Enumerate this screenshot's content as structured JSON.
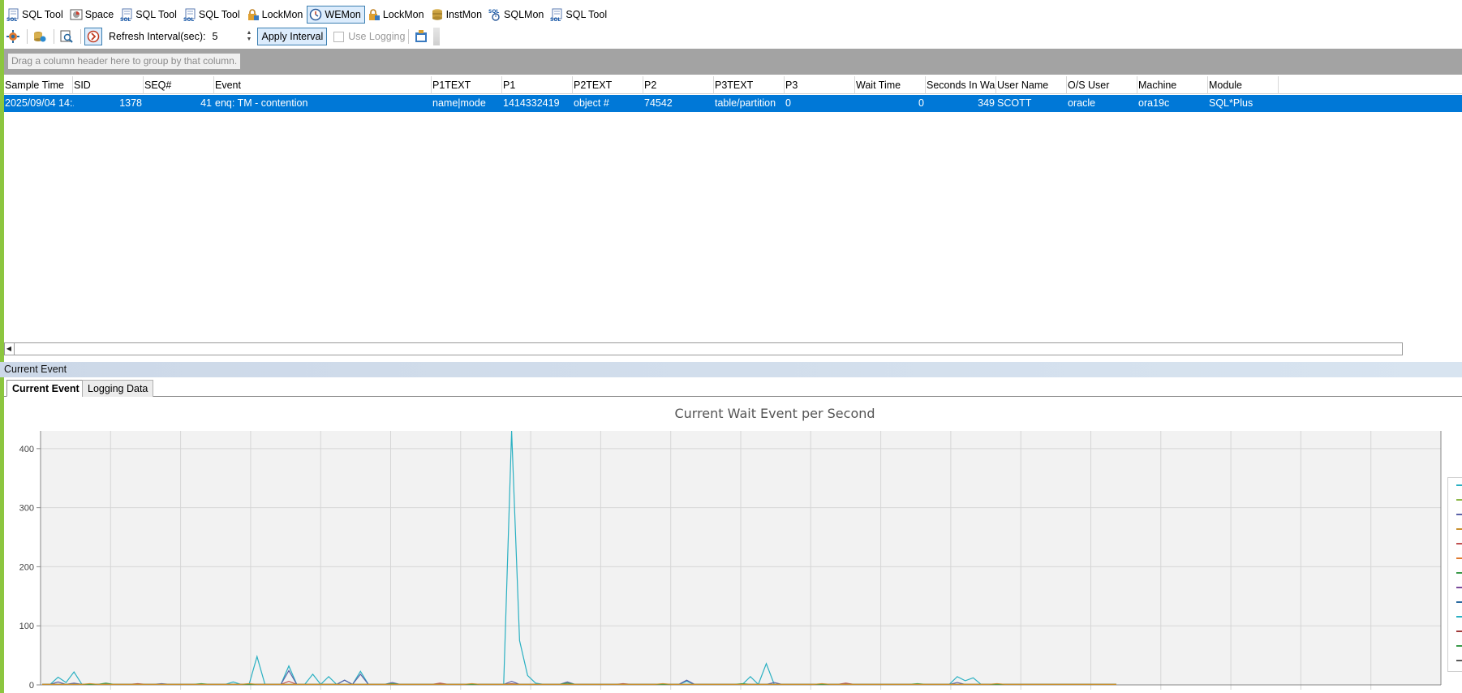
{
  "toolbar": {
    "tabs": [
      {
        "label": "SQL Tool",
        "icon": "sql-icon",
        "active": false
      },
      {
        "label": "Space",
        "icon": "space-icon",
        "active": false
      },
      {
        "label": "SQL Tool",
        "icon": "sql-icon",
        "active": false
      },
      {
        "label": "SQL Tool",
        "icon": "sql-icon",
        "active": false
      },
      {
        "label": "LockMon",
        "icon": "lock-icon",
        "active": false
      },
      {
        "label": "WEMon",
        "icon": "clock-icon",
        "active": true
      },
      {
        "label": "LockMon",
        "icon": "lock-icon",
        "active": false
      },
      {
        "label": "InstMon",
        "icon": "database-icon",
        "active": false
      },
      {
        "label": "SQLMon",
        "icon": "sqlmon-icon",
        "active": false
      },
      {
        "label": "SQL Tool",
        "icon": "sql-icon",
        "active": false
      }
    ],
    "refresh_label": "Refresh Interval(sec):",
    "refresh_value": "5",
    "apply_label": "Apply Interval",
    "use_logging_label": "Use Logging"
  },
  "group_panel": {
    "hint": "Drag a column header here to group by that column."
  },
  "grid": {
    "columns": [
      "Sample Time",
      "SID",
      "SEQ#",
      "Event",
      "P1TEXT",
      "P1",
      "P2TEXT",
      "P2",
      "P3TEXT",
      "P3",
      "Wait Time",
      "Seconds In Wait",
      "User Name",
      "O/S User",
      "Machine",
      "Module"
    ],
    "rows": [
      [
        "2025/09/04 14:...",
        "1378",
        "41",
        "enq: TM - contention",
        "name|mode",
        "1414332419",
        "object #",
        "74542",
        "table/partition",
        "0",
        "0",
        "349",
        "SCOTT",
        "oracle",
        "ora19c",
        "SQL*Plus"
      ]
    ]
  },
  "section": {
    "title": "Current Event"
  },
  "tabs": {
    "current_event": "Current Event",
    "logging_data": "Logging Data"
  },
  "chart_data": {
    "type": "line",
    "title": "Current Wait Event per Second",
    "xlabel": "",
    "ylabel": "",
    "ylim": [
      0,
      430
    ],
    "yticks": [
      0,
      100,
      200,
      300,
      400
    ],
    "grid": true,
    "x_count": 136,
    "series": [
      {
        "color": "#2ab0c2",
        "spikes": [
          [
            2,
            13
          ],
          [
            3,
            4
          ],
          [
            4,
            22
          ],
          [
            24,
            5
          ],
          [
            27,
            48
          ],
          [
            31,
            32
          ],
          [
            34,
            18
          ],
          [
            36,
            14
          ],
          [
            38,
            8
          ],
          [
            40,
            23
          ],
          [
            59,
            430
          ],
          [
            60,
            75
          ],
          [
            61,
            16
          ],
          [
            62,
            3
          ],
          [
            81,
            6
          ],
          [
            89,
            14
          ],
          [
            91,
            36
          ],
          [
            115,
            14
          ],
          [
            116,
            7
          ],
          [
            117,
            12
          ]
        ]
      },
      {
        "color": "#5b62a8",
        "spikes": [
          [
            2,
            5
          ],
          [
            4,
            3
          ],
          [
            15,
            2
          ],
          [
            31,
            24
          ],
          [
            38,
            8
          ],
          [
            40,
            18
          ],
          [
            44,
            4
          ],
          [
            59,
            6
          ],
          [
            66,
            5
          ],
          [
            81,
            8
          ],
          [
            92,
            4
          ],
          [
            115,
            4
          ]
        ]
      },
      {
        "color": "#c05050",
        "spikes": [
          [
            12,
            2
          ],
          [
            31,
            6
          ],
          [
            50,
            3
          ],
          [
            59,
            2
          ],
          [
            73,
            2
          ],
          [
            101,
            3
          ]
        ]
      },
      {
        "color": "#3a9a4a",
        "spikes": [
          [
            8,
            3
          ],
          [
            20,
            2
          ],
          [
            44,
            2
          ],
          [
            66,
            3
          ],
          [
            88,
            2
          ],
          [
            110,
            2
          ]
        ]
      },
      {
        "color": "#c89030",
        "spikes": [
          [
            6,
            2
          ],
          [
            26,
            2
          ],
          [
            54,
            2
          ],
          [
            78,
            2
          ],
          [
            98,
            2
          ],
          [
            120,
            2
          ]
        ]
      }
    ],
    "legend_colors": [
      "#2ab0c2",
      "#8db84a",
      "#5b62a8",
      "#c89030",
      "#c05050",
      "#e07a30",
      "#3a9a4a",
      "#7a4a9a",
      "#2a6aa0",
      "#2ab0c2",
      "#a03a3a",
      "#3a9a4a",
      "#5a5a5a"
    ]
  }
}
